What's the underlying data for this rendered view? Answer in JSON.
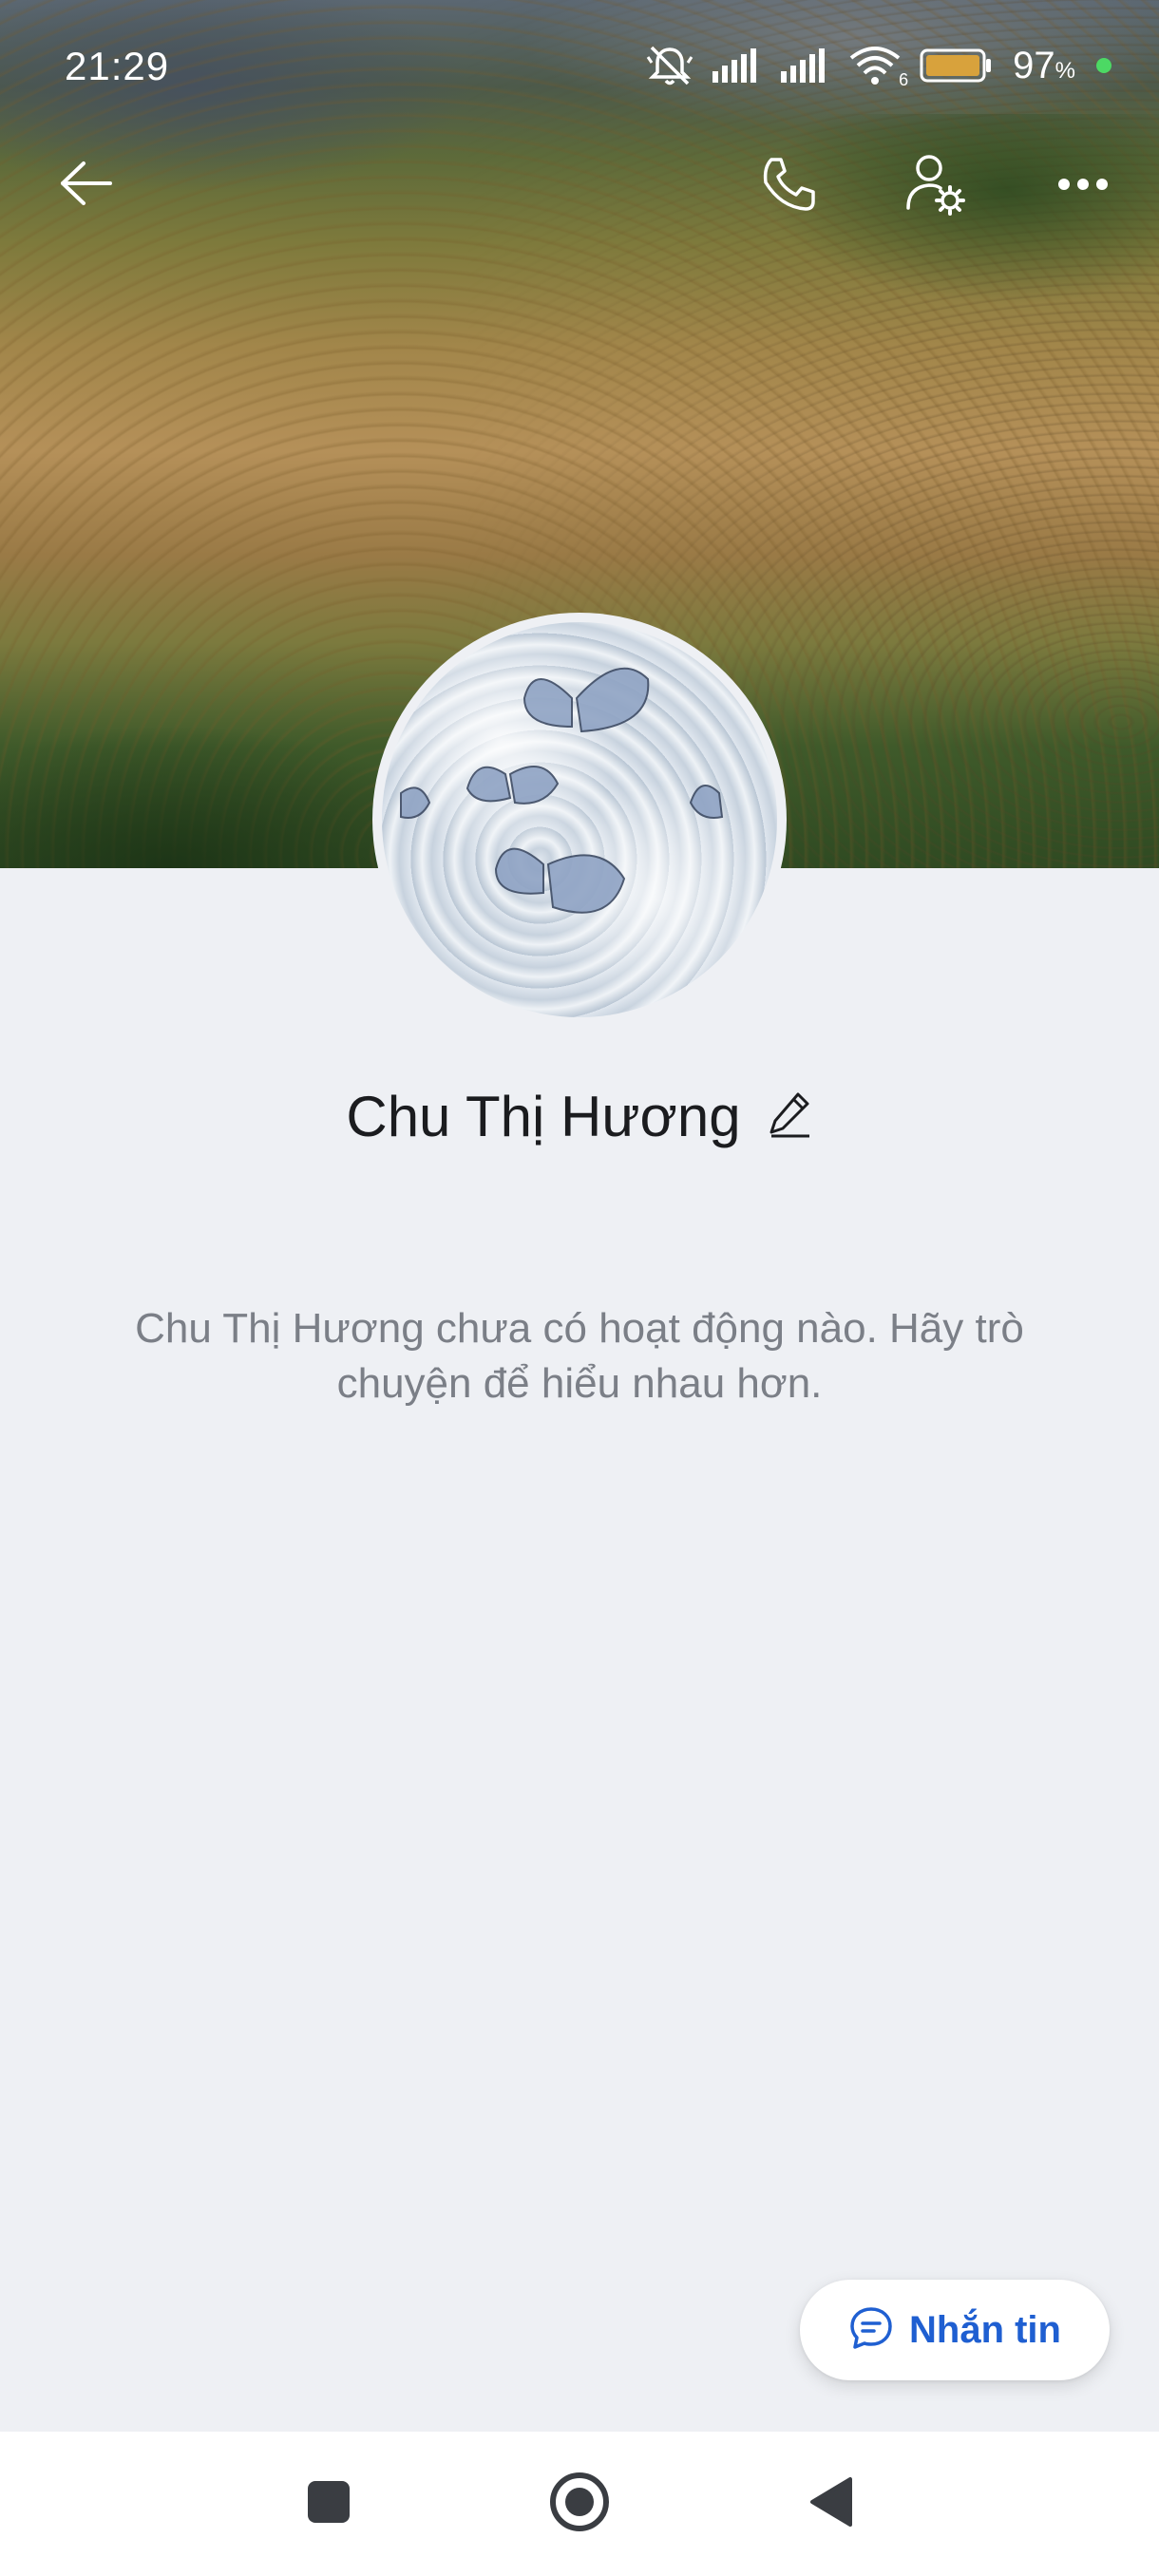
{
  "status_bar": {
    "time": "21:29",
    "battery_percent": "97",
    "battery_unit": "%",
    "wifi_badge": "6",
    "icons": [
      "mute-icon",
      "signal-icon",
      "signal-icon",
      "wifi-icon",
      "battery-icon"
    ]
  },
  "topbar": {
    "icons": [
      "back-arrow-icon",
      "phone-icon",
      "user-settings-icon",
      "more-icon"
    ]
  },
  "profile": {
    "name": "Chu Thị Hương",
    "empty_activity_message": "Chu Thị Hương chưa có hoạt động nào. Hãy trò chuyện để hiểu nhau hơn."
  },
  "actions": {
    "message_label": "Nhắn tin"
  },
  "navbar": {
    "icons": [
      "recent-apps-icon",
      "home-icon",
      "back-icon"
    ]
  },
  "colors": {
    "background": "#eef0f4",
    "accent": "#1f5fd1",
    "muted_text": "#7b7f87"
  }
}
